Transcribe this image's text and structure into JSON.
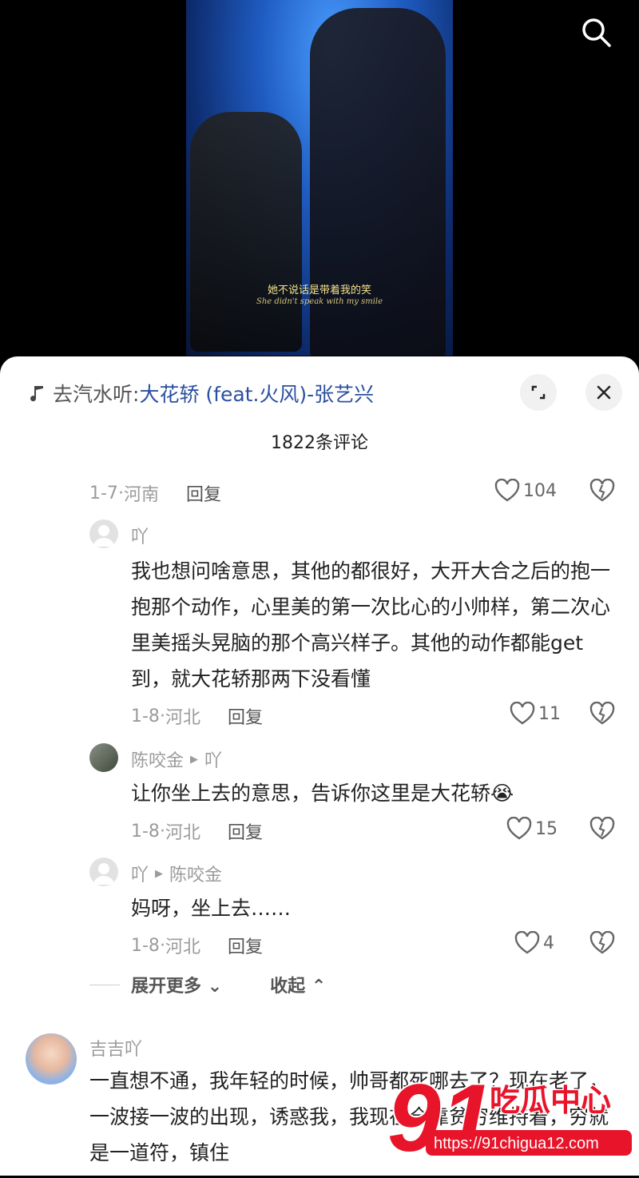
{
  "video": {
    "subtitle": "她不说话是带着我的笑",
    "subtitle_en": "She didn't speak with my smile"
  },
  "music": {
    "prefix": "去汽水听:",
    "song": "大花轿 (feat.火风)-张艺兴"
  },
  "comments_count": "1822条评论",
  "parent_meta": {
    "date": "1-7",
    "location": "河南",
    "reply": "回复",
    "likes": "104"
  },
  "replies": [
    {
      "author": "吖",
      "text": "我也想问啥意思，其他的都很好，大开大合之后的抱一抱那个动作，心里美的第一次比心的小帅样，第二次心里美摇头晃脑的那个高兴样子。其他的动作都能get到，就大花轿那两下没看懂",
      "date": "1-8",
      "location": "河北",
      "reply": "回复",
      "likes": "11"
    },
    {
      "author": "陈咬金",
      "reply_to": "吖",
      "text": "让你坐上去的意思，告诉你这里是大花轿😭",
      "date": "1-8",
      "location": "河北",
      "reply": "回复",
      "likes": "15"
    },
    {
      "author": "吖",
      "reply_to": "陈咬金",
      "text": "妈呀，坐上去……",
      "date": "1-8",
      "location": "河北",
      "reply": "回复",
      "likes": "4"
    }
  ],
  "expand_more": "展开更多",
  "collapse": "收起",
  "next_comment": {
    "author": "吉吉吖",
    "text": "一直想不通，我年轻的时候，帅哥都死哪去了？现在老了，一波接一波的出现，诱惑我，我现在全靠贫穷维持着，穷就是一道符，镇住"
  },
  "watermark": {
    "logo": "91",
    "brand": "吃瓜中心",
    "url": "https://91chigua12.com"
  },
  "colors": {
    "link": "#2b4fa0",
    "watermark_red": "#e8142a"
  }
}
